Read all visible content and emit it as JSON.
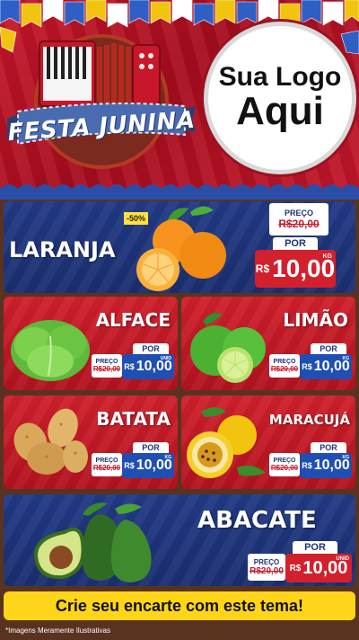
{
  "header": {
    "title": "FESTA JUNINA",
    "logo_line1": "Sua Logo",
    "logo_line2": "Aqui"
  },
  "products": [
    {
      "name": "LARANJA",
      "badge": "-50%",
      "old_label": "PREÇO",
      "old_price": "R$20,00",
      "new_label": "POR",
      "currency": "R$",
      "price": "10,00",
      "unit": "KG"
    },
    {
      "name": "ALFACE",
      "old_label": "PREÇO",
      "old_price": "R$20,00",
      "new_label": "POR",
      "currency": "R$",
      "price": "10,00",
      "unit": "UNID"
    },
    {
      "name": "LIMÃO",
      "old_label": "PREÇO",
      "old_price": "R$20,00",
      "new_label": "POR",
      "currency": "R$",
      "price": "10,00",
      "unit": "KG"
    },
    {
      "name": "BATATA",
      "old_label": "PREÇO",
      "old_price": "R$20,00",
      "new_label": "POR",
      "currency": "R$",
      "price": "10,00",
      "unit": "KG"
    },
    {
      "name": "MARACUJÁ",
      "old_label": "PREÇO",
      "old_price": "R$20,00",
      "new_label": "POR",
      "currency": "R$",
      "price": "10,00",
      "unit": "KG"
    },
    {
      "name": "ABACATE",
      "old_label": "PREÇO",
      "old_price": "R$20,00",
      "new_label": "POR",
      "currency": "R$",
      "price": "10,00",
      "unit": "UNID"
    }
  ],
  "footer": {
    "cta": "Crie seu encarte com este tema!",
    "disclaimer": "*Imagens Meramente Ilustrativas"
  },
  "colors": {
    "red": "#c8172a",
    "blue": "#1f3278",
    "yellow": "#ffd51a"
  },
  "icons": [
    "accordion-icon",
    "orange-icon",
    "lettuce-icon",
    "lime-icon",
    "potato-icon",
    "passion-fruit-icon",
    "avocado-icon"
  ]
}
